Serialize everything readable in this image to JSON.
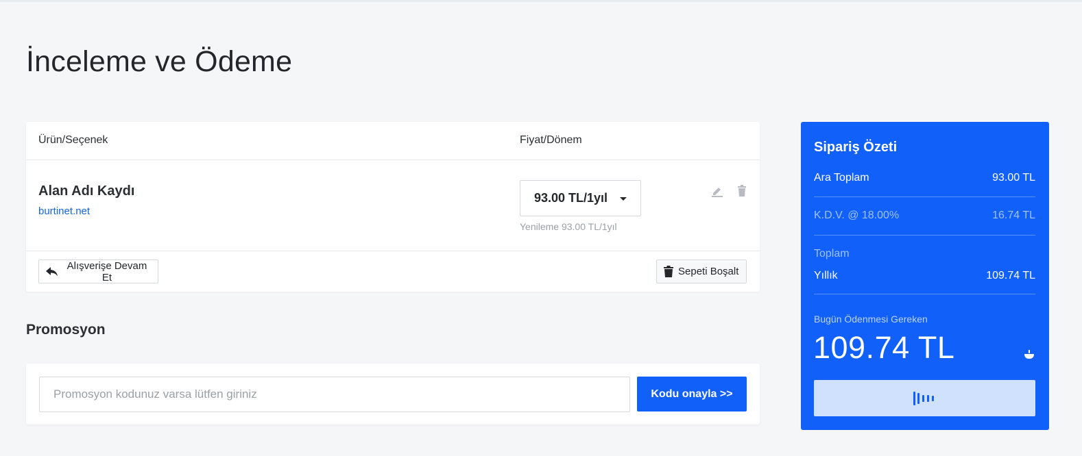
{
  "page": {
    "title": "İnceleme ve Ödeme"
  },
  "cart": {
    "columns": {
      "product": "Ürün/Seçenek",
      "price": "Fiyat/Dönem"
    },
    "items": [
      {
        "name": "Alan Adı Kaydı",
        "domain": "burtinet.net",
        "price_period": "93.00 TL/1yıl",
        "renewal": "Yenileme 93.00 TL/1yıl",
        "actions": [
          "edit-icon",
          "trash-icon"
        ]
      }
    ],
    "continue_label": "Alışverişe Devam Et",
    "empty_label": "Sepeti Boşalt"
  },
  "promo": {
    "title": "Promosyon",
    "placeholder": "Promosyon kodunuz varsa lütfen giriniz",
    "button_label": "Kodu onayla >>"
  },
  "summary": {
    "title": "Sipariş Özeti",
    "subtotal_label": "Ara Toplam",
    "subtotal_value": "93.00 TL",
    "tax_label": "K.D.V. @ 18.00%",
    "tax_value": "16.74 TL",
    "total_label": "Toplam",
    "annual_label": "Yıllık",
    "annual_value": "109.74 TL",
    "due_label": "Bugün Ödenmesi Gereken",
    "due_amount": "109.74 TL",
    "checkout_icon": "loading-bars-icon"
  },
  "colors": {
    "accent": "#1260fa",
    "background": "#f5f6f8",
    "link": "#1565e0",
    "checkout_button": "#cfe1fd"
  }
}
